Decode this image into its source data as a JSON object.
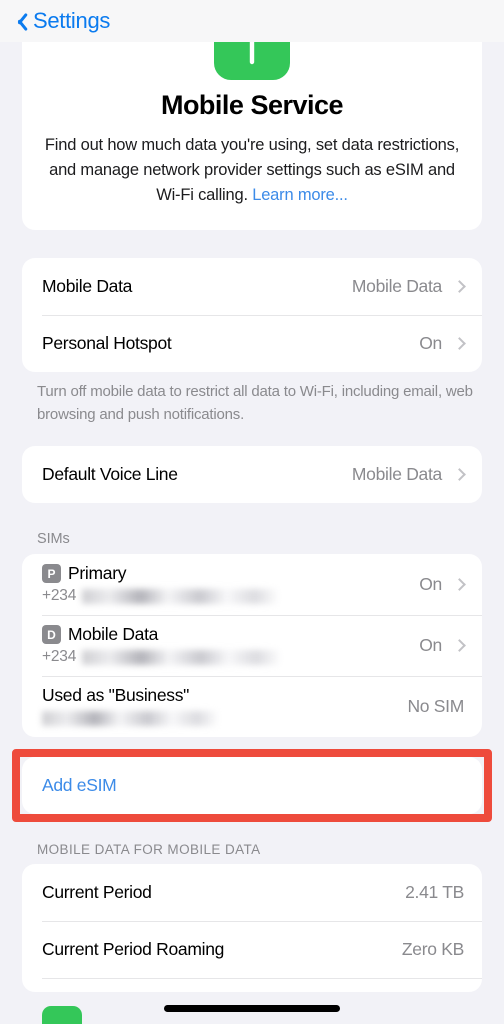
{
  "navbar": {
    "back_label": "Settings",
    "back_icon": "chevron-left-icon"
  },
  "header": {
    "icon": "cellular-antenna-icon",
    "icon_color": "#34C759",
    "title": "Mobile Service",
    "description": "Find out how much data you're using, set data restrictions, and manage network provider settings such as eSIM and Wi-Fi calling. ",
    "link_label": "Learn more..."
  },
  "data_group": {
    "rows": [
      {
        "label": "Mobile Data",
        "value": "Mobile Data",
        "chevron": true
      },
      {
        "label": "Personal Hotspot",
        "value": "On",
        "chevron": true
      }
    ],
    "footer": "Turn off mobile data to restrict all data to Wi-Fi, including email, web browsing and push notifications."
  },
  "voice_group": {
    "rows": [
      {
        "label": "Default Voice Line",
        "value": "Mobile Data",
        "chevron": true
      }
    ]
  },
  "sims": {
    "header": "SIMs",
    "rows": [
      {
        "badge": "P",
        "title": "Primary",
        "prefix": "+234",
        "redacted": true,
        "value": "On",
        "chevron": true
      },
      {
        "badge": "D",
        "title": "Mobile Data",
        "prefix": "+234",
        "redacted": true,
        "value": "On",
        "chevron": true
      },
      {
        "badge": "",
        "title": "Used as \"Business\"",
        "prefix": "",
        "redacted": true,
        "value": "No SIM",
        "chevron": false
      }
    ]
  },
  "add_esim": {
    "label": "Add eSIM",
    "highlight_color": "#EE4B3C"
  },
  "usage": {
    "header": "MOBILE DATA FOR MOBILE DATA",
    "rows": [
      {
        "label": "Current Period",
        "value": "2.41 TB"
      },
      {
        "label": "Current Period Roaming",
        "value": "Zero KB"
      }
    ]
  },
  "colors": {
    "accent": "#0B7BEF",
    "link": "#3C8BE8",
    "green": "#34C759",
    "background": "#F2F2F7"
  }
}
